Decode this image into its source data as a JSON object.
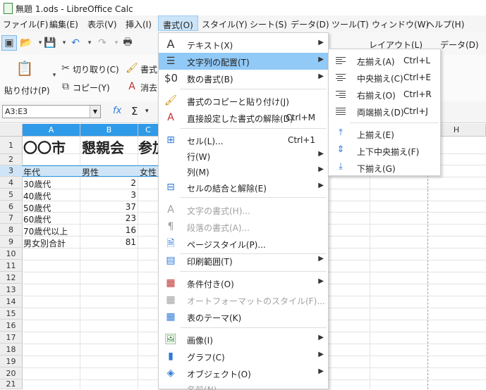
{
  "window": {
    "title": "無題 1.ods - LibreOffice Calc"
  },
  "menubar": [
    "ファイル(F)",
    "編集(E)",
    "表示(V)",
    "挿入(I)",
    "書式(O)",
    "スタイル(Y)",
    "シート(S)",
    "データ(D)",
    "ツール(T)",
    "ウィンドウ(W)",
    "ヘルプ(H)"
  ],
  "toolbar": {
    "paste_label": "貼り付け(P)",
    "cut_label": "切り取り(C)",
    "copy_label": "コピー(Y)",
    "format_partial": "書式",
    "clear_partial": "消去",
    "tab_layout": "レイアウト(L)",
    "tab_data": "データ(D)"
  },
  "formula_bar": {
    "name_box": "A3:E3",
    "fx": "fx",
    "sigma": "Σ"
  },
  "columns": [
    "A",
    "B",
    "C",
    "H"
  ],
  "rows": [
    "1",
    "2",
    "3",
    "4",
    "5",
    "6",
    "7",
    "8",
    "9",
    "10",
    "11",
    "12",
    "13",
    "14",
    "15",
    "16",
    "17",
    "18",
    "19",
    "20",
    "21"
  ],
  "cells": {
    "A1": "〇〇市",
    "B1": "懇親会",
    "C1": "参加",
    "A3": "年代",
    "B3": "男性",
    "C3": "女性",
    "A4": "30歳代",
    "B4": "2",
    "A5": "40歳代",
    "B5": "3",
    "A6": "50歳代",
    "B6": "37",
    "A7": "60歳代",
    "B7": "23",
    "A8": "70歳代以上",
    "B8": "16",
    "A9": "男女別合計",
    "B9": "81"
  },
  "format_menu": [
    {
      "label": "テキスト(X)",
      "icon": "text-icon",
      "submenu": true
    },
    {
      "label": "文字列の配置(T)",
      "icon": "align-icon",
      "submenu": true,
      "highlighted": true
    },
    {
      "label": "数の書式(B)",
      "icon": "currency-icon",
      "submenu": true
    },
    {
      "label": "書式のコピーと貼り付け(J)",
      "icon": "clone-format-icon"
    },
    {
      "label": "直接設定した書式の解除(D)",
      "icon": "clear-format-icon",
      "shortcut": "Ctrl+M"
    },
    {
      "label": "セル(L)...",
      "icon": "cell-icon",
      "shortcut": "Ctrl+1"
    },
    {
      "label": "行(W)",
      "submenu": true
    },
    {
      "label": "列(M)",
      "submenu": true
    },
    {
      "label": "セルの結合と解除(E)",
      "icon": "merge-icon",
      "submenu": true
    },
    {
      "label": "文字の書式(H)...",
      "icon": "char-format-icon",
      "disabled": true
    },
    {
      "label": "段落の書式(A)...",
      "icon": "paragraph-icon",
      "disabled": true
    },
    {
      "label": "ページスタイル(P)...",
      "icon": "page-style-icon"
    },
    {
      "label": "印刷範囲(T)",
      "icon": "print-range-icon",
      "submenu": true
    },
    {
      "label": "条件付き(O)",
      "icon": "conditional-icon",
      "submenu": true
    },
    {
      "label": "オートフォーマットのスタイル(F)...",
      "icon": "autoformat-icon",
      "disabled": true
    },
    {
      "label": "表のテーマ(K)",
      "icon": "table-theme-icon"
    },
    {
      "label": "画像(I)",
      "icon": "image-icon",
      "submenu": true
    },
    {
      "label": "グラフ(C)",
      "icon": "chart-icon",
      "submenu": true
    },
    {
      "label": "オブジェクト(O)",
      "icon": "object-icon",
      "submenu": true
    },
    {
      "label": "名前(N)",
      "disabled": true
    }
  ],
  "align_submenu": [
    {
      "label": "左揃え(A)",
      "shortcut": "Ctrl+L",
      "icon": "align-left-icon"
    },
    {
      "label": "中央揃え(C)",
      "shortcut": "Ctrl+E",
      "icon": "align-center-icon"
    },
    {
      "label": "右揃え(O)",
      "shortcut": "Ctrl+R",
      "icon": "align-right-icon"
    },
    {
      "label": "両端揃え(D)",
      "shortcut": "Ctrl+J",
      "icon": "justify-icon"
    },
    {
      "label": "上揃え(E)",
      "icon": "align-top-icon"
    },
    {
      "label": "上下中央揃え(F)",
      "icon": "align-middle-icon"
    },
    {
      "label": "下揃え(G)",
      "icon": "align-bottom-icon"
    }
  ],
  "colors": {
    "selection": "#2f9ae8",
    "menu_highlight": "#91c9f7",
    "menubar_active": "#cce4f7"
  }
}
